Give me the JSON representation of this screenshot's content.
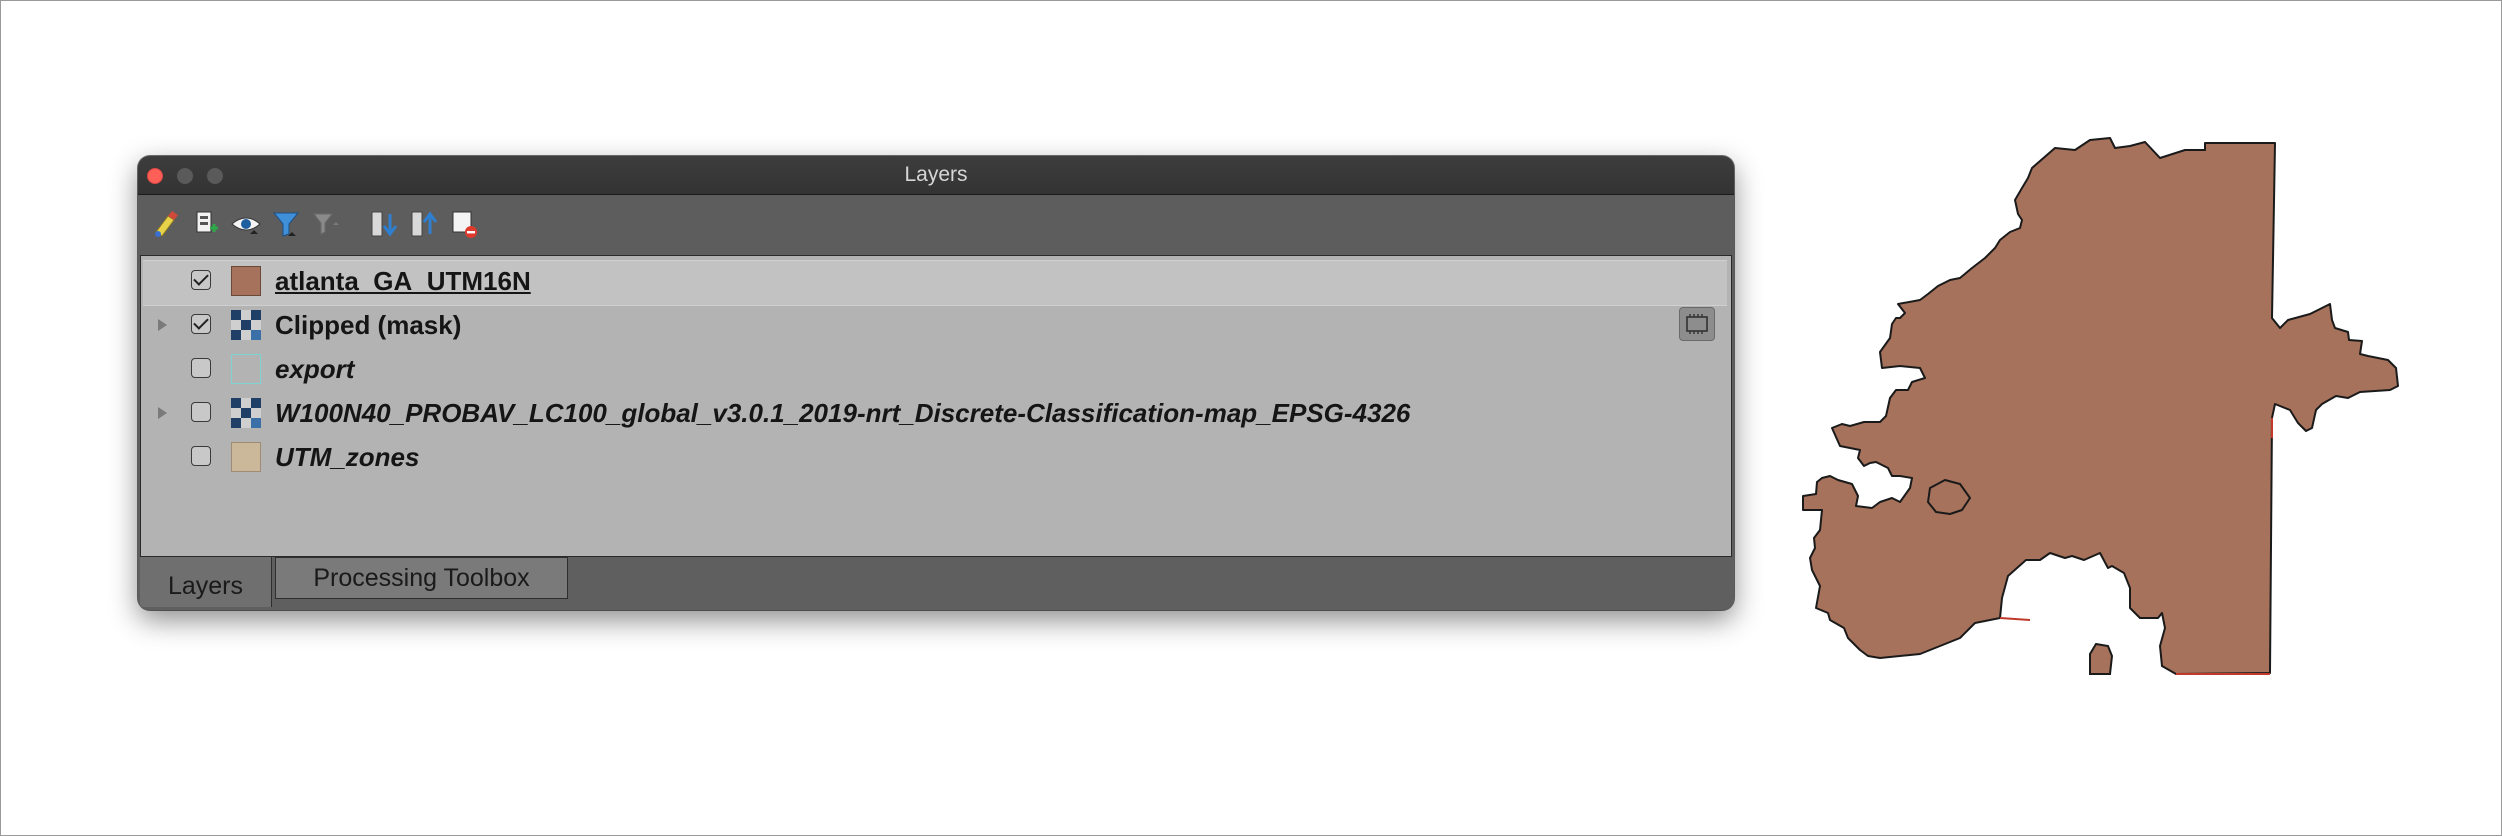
{
  "window": {
    "title": "Layers"
  },
  "toolbar": {
    "icons": [
      "style-manager-icon",
      "add-group-icon",
      "visibility-icon",
      "filter-legend-icon",
      "filter-by-expression-icon",
      "expand-all-icon",
      "collapse-all-icon",
      "remove-layer-icon"
    ]
  },
  "layers": [
    {
      "name": "atlanta_GA_UTM16N",
      "checked": true,
      "symbol": "polygon",
      "color": "#a6725b",
      "selected": true
    },
    {
      "name": "Clipped (mask)",
      "checked": true,
      "symbol": "raster",
      "expandable": true
    },
    {
      "name": "export",
      "checked": false,
      "symbol": "polygon-empty",
      "color": "#7fd3d3"
    },
    {
      "name": "W100N40_PROBAV_LC100_global_v3.0.1_2019-nrt_Discrete-Classification-map_EPSG-4326",
      "checked": false,
      "symbol": "raster",
      "expandable": true
    },
    {
      "name": "UTM_zones",
      "checked": false,
      "symbol": "polygon",
      "color": "#cbb79a"
    }
  ],
  "tabs": [
    "Layers",
    "Processing Toolbox"
  ],
  "map": {
    "feature_color": "#a6725b"
  }
}
